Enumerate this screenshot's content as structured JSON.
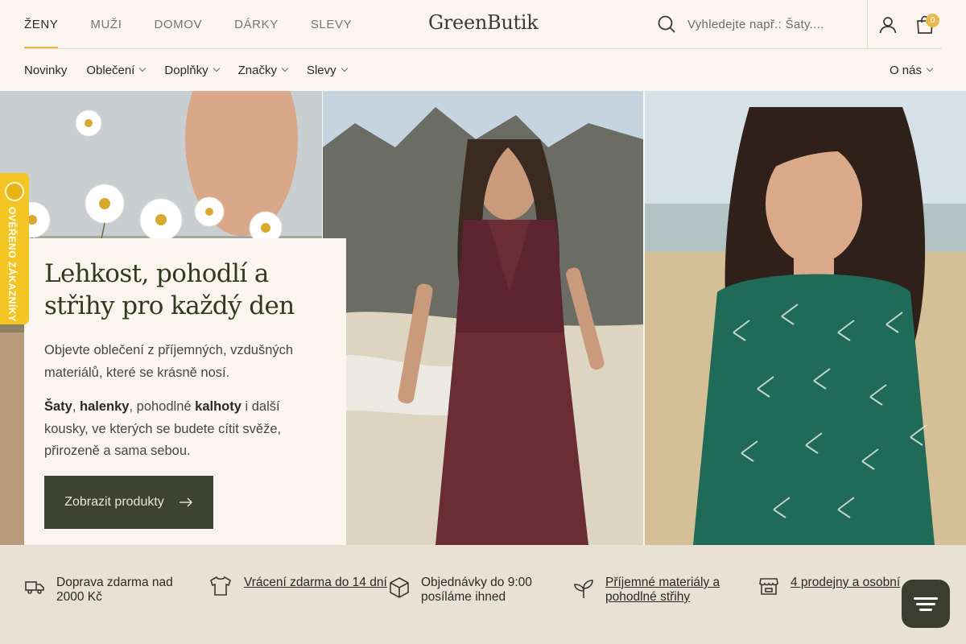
{
  "header": {
    "gender_tabs": [
      "ŽENY",
      "MUŽI",
      "DOMOV",
      "DÁRKY",
      "SLEVY"
    ],
    "active_tab": "ŽENY",
    "logo": "GreenButik",
    "search_placeholder": "Vyhledejte např.: Šaty....",
    "cart_count": "0"
  },
  "category_nav": {
    "items": [
      "Novinky",
      "Oblečení",
      "Doplňky",
      "Značky",
      "Slevy"
    ],
    "about": "O nás"
  },
  "hero": {
    "title": "Lehkost, pohodlí a střihy pro každý den",
    "intro": "Objevte oblečení z příjemných, vzdušných materiálů, které se krásně nosí.",
    "bold1": "Šaty",
    "sep1": ", ",
    "bold2": "halenky",
    "mid": ", pohodlné ",
    "bold3": "kalhoty",
    "rest": " i další kousky, ve kterých se budete cítit svěže, přirozeně a sama sebou.",
    "cta_label": "Zobrazit produkty"
  },
  "badge": {
    "text": "OVĚŘENO ZÁKAZNÍKY"
  },
  "benefits": [
    {
      "icon": "truck-icon",
      "text": "Doprava zdarma nad 2000 Kč"
    },
    {
      "icon": "tshirt-icon",
      "text": "Vrácení zdarma do 14 dní"
    },
    {
      "icon": "box-icon",
      "text": "Objednávky do 9:00 posíláme ihned"
    },
    {
      "icon": "leaf-icon",
      "text": "Příjemné materiály a pohodlné střihy"
    },
    {
      "icon": "store-icon",
      "text": "4 prodejny a osobní"
    }
  ],
  "colors": {
    "accent": "#e8b84b",
    "cta": "#3e4232",
    "badge": "#f3c623",
    "background": "#faf5ee"
  }
}
